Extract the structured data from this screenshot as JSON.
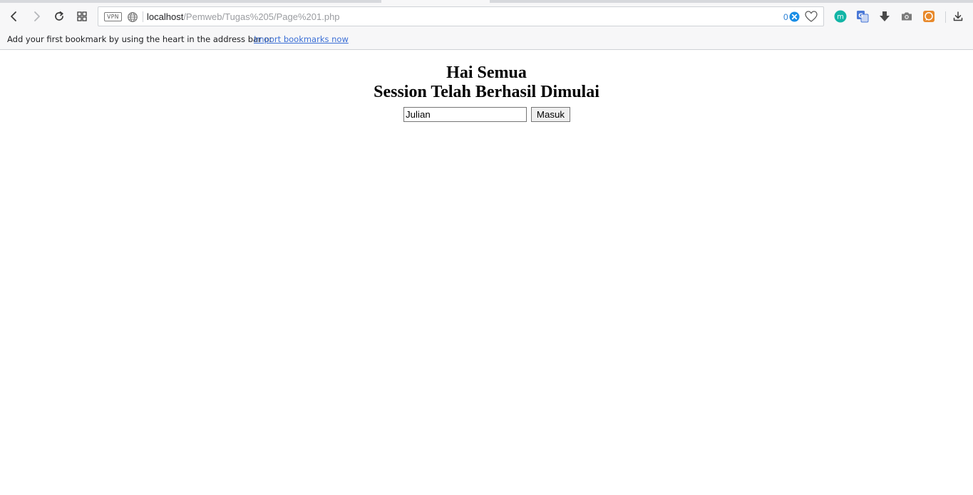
{
  "browser": {
    "address_bar": {
      "vpn_label": "VPN",
      "url_host": "localhost",
      "url_path": "/Pemweb/Tugas%205/Page%201.php",
      "adblock_count": "0"
    },
    "bookmarks_bar": {
      "message": "Add your first bookmark by using the heart in the address bar or",
      "import_link": "Import bookmarks now"
    },
    "extensions": [
      {
        "name": "m",
        "color": "#12b5a6"
      },
      {
        "name": "translate",
        "color": "#4a78d6"
      },
      {
        "name": "download-arrow",
        "color": "#4a4a4a"
      },
      {
        "name": "camera",
        "color": "#7a7a7a"
      },
      {
        "name": "chat",
        "color": "#e8892b"
      }
    ]
  },
  "page": {
    "heading_1": "Hai Semua",
    "heading_2": "Session Telah Berhasil Dimulai",
    "name_input_value": "Julian",
    "submit_label": "Masuk"
  }
}
